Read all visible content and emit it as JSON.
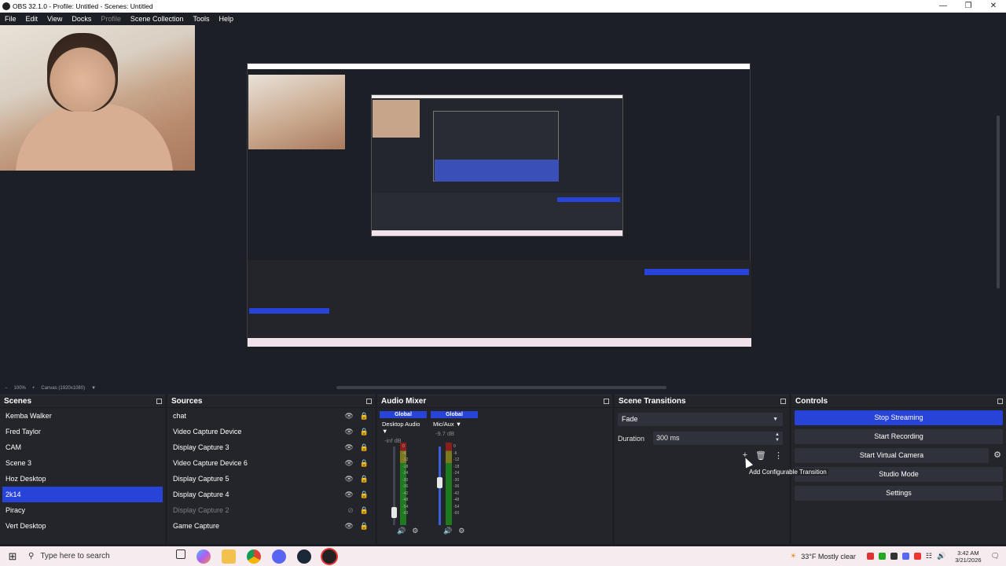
{
  "window": {
    "title": "OBS 32.1.0 - Profile: Untitled - Scenes: Untitled",
    "controls": [
      "—",
      "❐",
      "✕"
    ]
  },
  "menu": [
    "File",
    "Edit",
    "View",
    "Docks",
    "Profile",
    "Scene Collection",
    "Tools",
    "Help"
  ],
  "status": {
    "zoom": "100%",
    "canvas": "Canvas (1920x1080)"
  },
  "scenes": {
    "title": "Scenes",
    "items": [
      "Kemba Walker",
      "Fred Taylor",
      "CAM",
      "Scene 3",
      "Hoz Desktop",
      "2k14",
      "Piracy",
      "Vert Desktop"
    ],
    "selected": "2k14"
  },
  "sources": {
    "title": "Sources",
    "items": [
      "chat",
      "Video Capture Device",
      "Display Capture 3",
      "Video Capture Device 6",
      "Display Capture 5",
      "Display Capture 4",
      "Display Capture 2",
      "Game Capture"
    ],
    "hidden": "Display Capture 2"
  },
  "mixer": {
    "title": "Audio Mixer",
    "channels": [
      {
        "global": "Global",
        "name": "Desktop Audio",
        "db": "-inf dB",
        "fader": 0.1
      },
      {
        "global": "Global",
        "name": "Mic/Aux",
        "db": "-9.7 dB",
        "fader": 0.55
      }
    ],
    "ticks": [
      "0",
      "-6",
      "-12",
      "-18",
      "-24",
      "-30",
      "-36",
      "-42",
      "-48",
      "-54",
      "-60"
    ]
  },
  "transitions": {
    "title": "Scene Transitions",
    "selected": "Fade",
    "duration_label": "Duration",
    "duration_value": "300 ms",
    "tooltip": "Add Configurable Transition"
  },
  "controls": {
    "title": "Controls",
    "buttons": [
      "Stop Streaming",
      "Start Recording",
      "Start Virtual Camera",
      "Studio Mode",
      "Settings"
    ]
  },
  "taskbar": {
    "search_placeholder": "Type here to search",
    "weather": "33°F  Mostly clear",
    "time": "3:42 AM",
    "date": "3/21/2026"
  },
  "colors": {
    "accent": "#2743d8",
    "background": "#1d1f26",
    "dock": "#23252b"
  }
}
